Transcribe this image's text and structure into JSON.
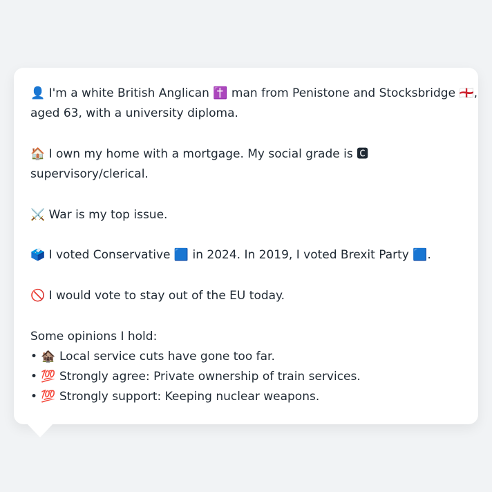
{
  "profile": {
    "line1": "👤 I'm a white British Anglican ✝️ man from Penistone and Stocksbridge 🏴󠁧󠁢󠁥󠁮󠁧󠁿,",
    "line2": "aged 63, with a university diploma.",
    "line3": "🏠 I own my home with a mortgage. My social grade is 🅲",
    "line4": "supervisory/clerical.",
    "line5": "⚔️ War is my top issue.",
    "line6": "🗳️ I voted Conservative 🟦 in 2024. In 2019, I voted Brexit Party 🟦.",
    "line7": "🚫 I would vote to stay out of the EU today.",
    "opinions_heading": "Some opinions I hold:",
    "opinion1": "• 🏚️ Local service cuts have gone too far.",
    "opinion2": "• 💯 Strongly agree: Private ownership of train services.",
    "opinion3": "• 💯 Strongly support: Keeping nuclear weapons."
  }
}
